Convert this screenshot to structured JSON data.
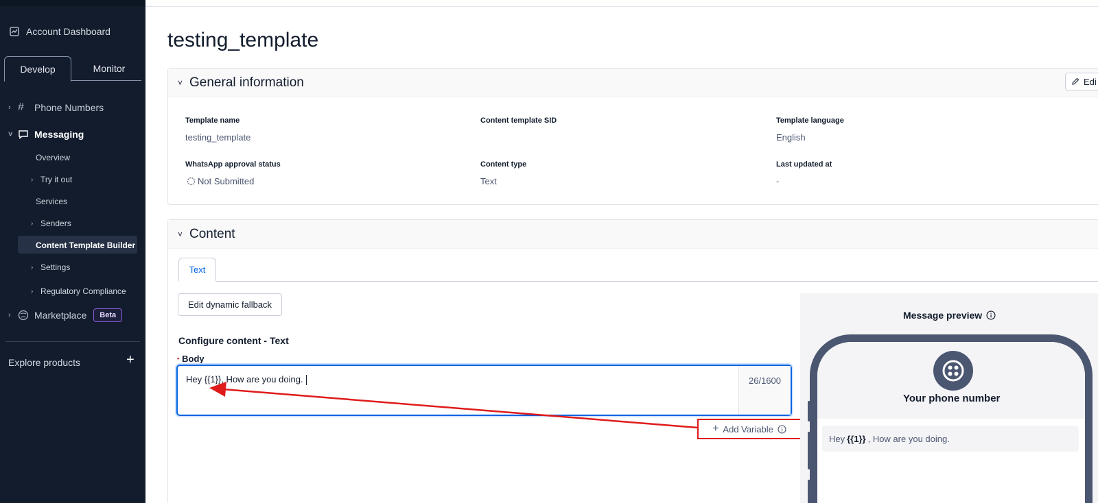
{
  "sidebar": {
    "account_dashboard": "Account Dashboard",
    "tabs": {
      "develop": "Develop",
      "monitor": "Monitor"
    },
    "phone_numbers": "Phone Numbers",
    "messaging": "Messaging",
    "messaging_items": {
      "overview": "Overview",
      "try_it_out": "Try it out",
      "services": "Services",
      "senders": "Senders",
      "content_template_builder": "Content Template Builder",
      "settings": "Settings",
      "regulatory_compliance": "Regulatory Compliance"
    },
    "marketplace": "Marketplace",
    "beta_badge": "Beta",
    "explore_products": "Explore products"
  },
  "page": {
    "title": "testing_template"
  },
  "general_info": {
    "heading": "General information",
    "edit_label": "Edi",
    "fields": {
      "template_name_label": "Template name",
      "template_name_value": "testing_template",
      "content_sid_label": "Content template SID",
      "content_sid_value": "",
      "language_label": "Template language",
      "language_value": "English",
      "whatsapp_status_label": "WhatsApp approval status",
      "whatsapp_status_value": "Not Submitted",
      "content_type_label": "Content type",
      "content_type_value": "Text",
      "last_updated_label": "Last updated at",
      "last_updated_value": "-"
    }
  },
  "content": {
    "heading": "Content",
    "tab_text": "Text",
    "fallback_button": "Edit dynamic fallback",
    "configure_title": "Configure content - Text",
    "body_label": "Body",
    "body_value": "Hey {{1}}, How are you doing.",
    "counter": "26/1600",
    "add_variable": "Add Variable"
  },
  "preview": {
    "title": "Message preview",
    "phone_name": "Your phone number",
    "message_prefix": "Hey",
    "message_variable": "{{1}}",
    "message_suffix": ", How are you doing."
  },
  "colors": {
    "sidebar_bg": "#121c2d",
    "accent_blue": "#0263e0",
    "annotation_red": "#e01b1b"
  }
}
